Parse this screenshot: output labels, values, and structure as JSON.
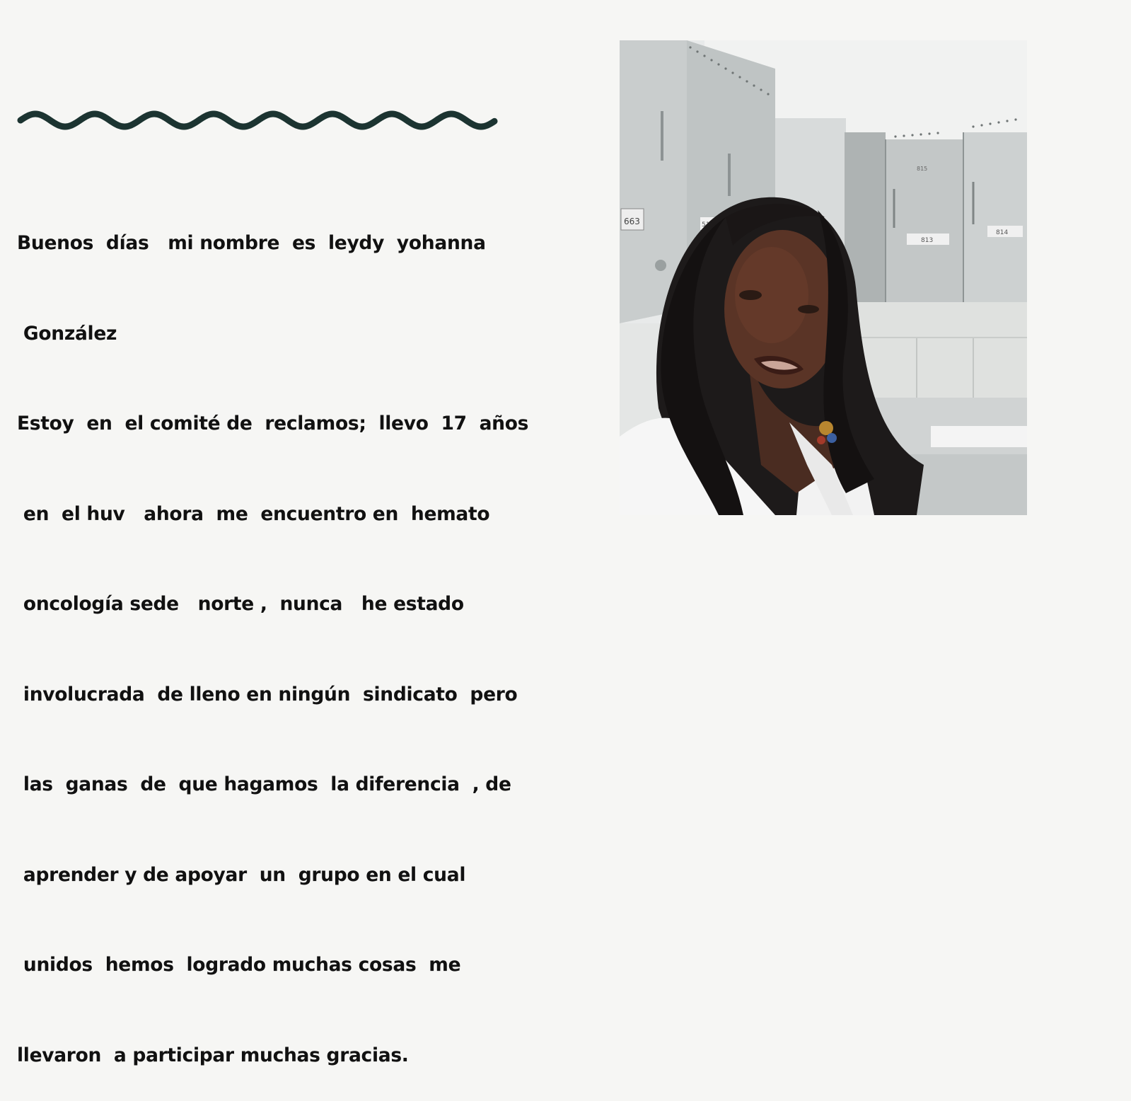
{
  "intro": {
    "lines": [
      "Buenos  días   mi nombre  es  leydy  yohanna",
      " González",
      "Estoy  en  el comité de  reclamos;  llevo  17  años",
      " en  el huv   ahora  me  encuentro en  hemato",
      " oncología sede   norte ,  nunca   he estado",
      " involucrada  de lleno en ningún  sindicato  pero",
      " las  ganas  de  que hagamos  la diferencia  , de",
      " aprender y de apoyar  un  grupo en el cual",
      " unidos  hemos  logrado muchas cosas  me",
      "llevaron  a participar muchas gracias."
    ]
  },
  "decoration": {
    "wave_color": "#1c3431"
  },
  "photo": {
    "subject": "selfie-portrait-photo",
    "locker_labels": [
      "663",
      "5132",
      "813",
      "814",
      "815"
    ]
  }
}
